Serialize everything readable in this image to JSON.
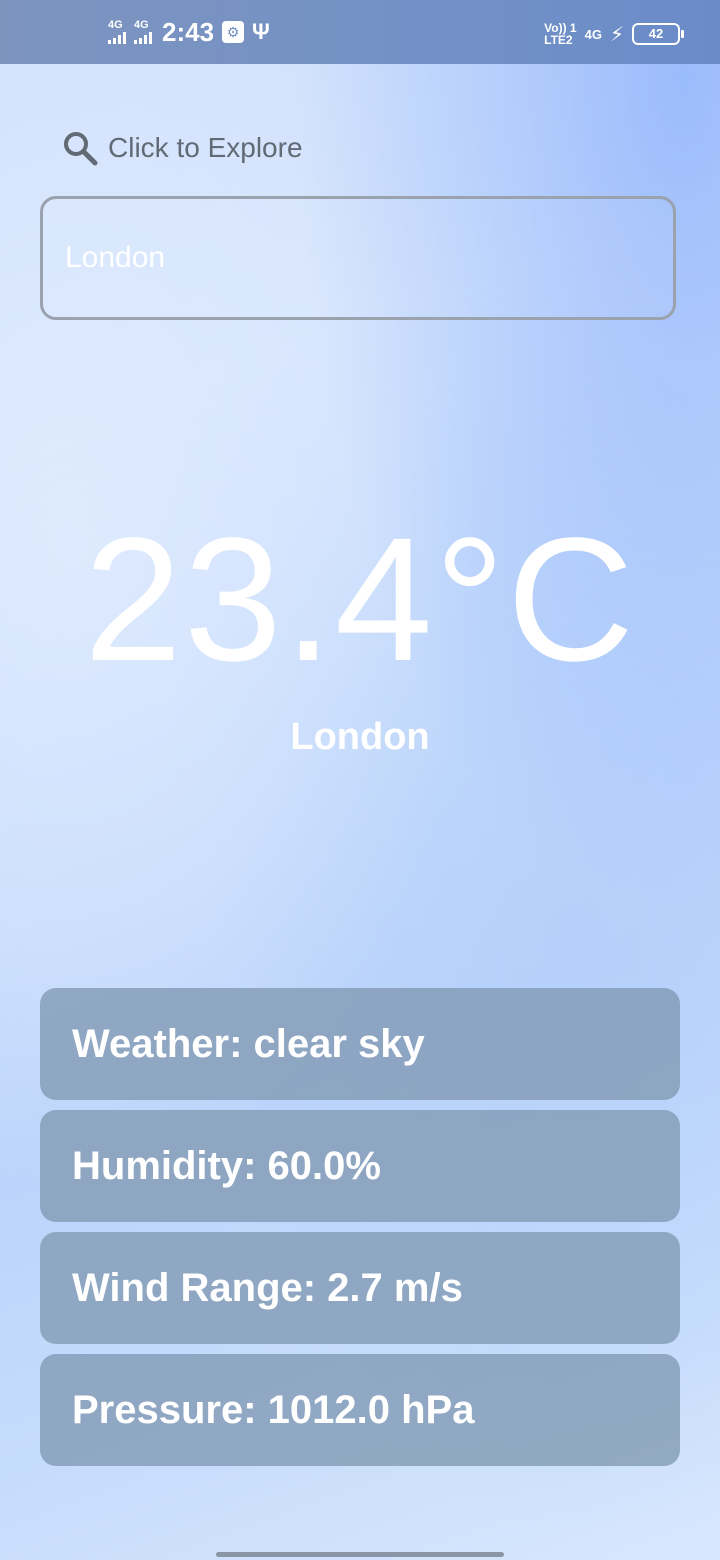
{
  "status_bar": {
    "sim1_network": "4G",
    "sim2_network": "4G",
    "time": "2:43",
    "volte_top": "Vo)) 1",
    "volte_bottom": "LTE2",
    "data_network": "4G",
    "battery_level": "42",
    "signal_strength_bars": 4,
    "icons": [
      "signal-icon",
      "app-notification-icon",
      "usb-icon",
      "volte-icon",
      "charging-bolt-icon",
      "battery-icon"
    ]
  },
  "explore": {
    "label": "Click to Explore",
    "icon": "search-icon"
  },
  "search": {
    "value": "London"
  },
  "weather": {
    "temperature": "23.4°C",
    "city": "London"
  },
  "details": {
    "weather": "Weather: clear sky",
    "humidity": "Humidity: 60.0%",
    "wind": "Wind Range: 2.7 m/s",
    "pressure": "Pressure: 1012.0 hPa"
  },
  "colors": {
    "card_background": "#8098b2",
    "status_bar": "#7291c6",
    "explore_text": "#616a75",
    "text_white": "#ffffff"
  }
}
